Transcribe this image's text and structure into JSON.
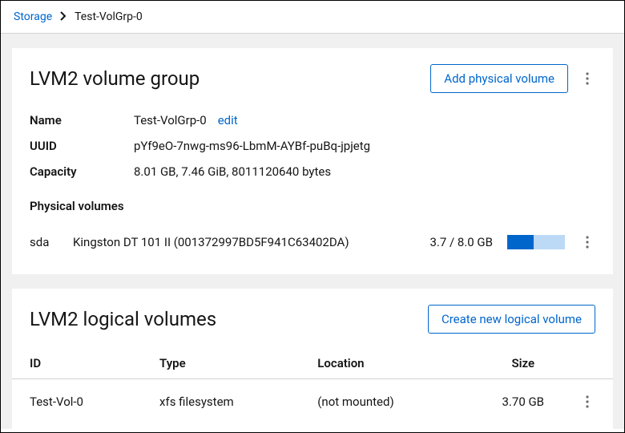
{
  "breadcrumb": {
    "root": "Storage",
    "current": "Test-VolGrp-0"
  },
  "vg": {
    "title": "LVM2 volume group",
    "add_pv_label": "Add physical volume",
    "labels": {
      "name": "Name",
      "uuid": "UUID",
      "capacity": "Capacity"
    },
    "name": "Test-VolGrp-0",
    "edit_label": "edit",
    "uuid": "pYf9eO-7nwg-ms96-LbmM-AYBf-puBq-jpjetg",
    "capacity": "8.01 GB, 7.46 GiB, 8011120640 bytes",
    "pv_heading": "Physical volumes",
    "pv": {
      "device": "sda",
      "desc": "Kingston DT 101 II (001372997BD5F941C63402DA)",
      "size": "3.7 / 8.0 GB",
      "usage_pct": "46"
    }
  },
  "lv": {
    "title": "LVM2 logical volumes",
    "create_label": "Create new logical volume",
    "columns": {
      "id": "ID",
      "type": "Type",
      "location": "Location",
      "size": "Size"
    },
    "row": {
      "id": "Test-Vol-0",
      "type": "xfs filesystem",
      "location": "(not mounted)",
      "size": "3.70 GB"
    }
  }
}
